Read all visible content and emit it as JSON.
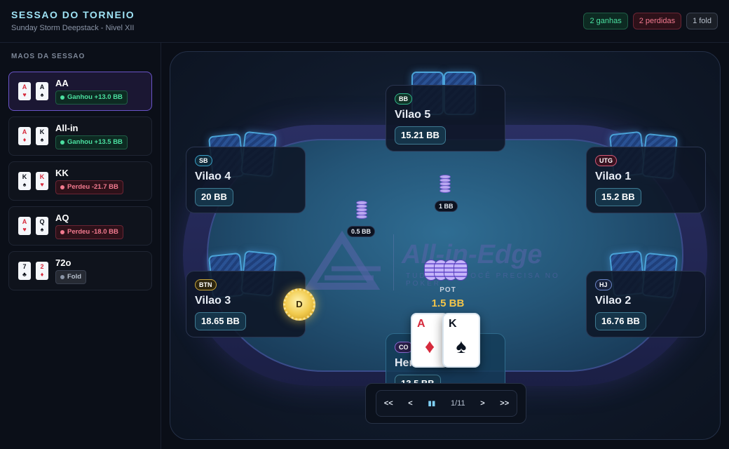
{
  "header": {
    "title": "SESSAO DO TORNEIO",
    "subtitle": "Sunday Storm Deepstack - Nivel XII",
    "badges": {
      "wins": "2 ganhas",
      "losses": "2 perdidas",
      "folds": "1 fold"
    }
  },
  "sidebar": {
    "title": "MAOS DA SESSAO",
    "hands": [
      {
        "name": "AA",
        "cards": [
          {
            "rank": "A",
            "suit": "♥"
          },
          {
            "rank": "A",
            "suit": "♠"
          }
        ],
        "result": "Ganhou +13.0 BB"
      },
      {
        "name": "All-in",
        "cards": [
          {
            "rank": "A",
            "suit": "♦"
          },
          {
            "rank": "K",
            "suit": "♠"
          }
        ],
        "result": "Ganhou +13.5 BB"
      },
      {
        "name": "KK",
        "cards": [
          {
            "rank": "K",
            "suit": "♠"
          },
          {
            "rank": "K",
            "suit": "♥"
          }
        ],
        "result": "Perdeu -21.7 BB"
      },
      {
        "name": "AQ",
        "cards": [
          {
            "rank": "A",
            "suit": "♥"
          },
          {
            "rank": "Q",
            "suit": "♠"
          }
        ],
        "result": "Perdeu -18.0 BB"
      },
      {
        "name": "72o",
        "cards": [
          {
            "rank": "7",
            "suit": "♣"
          },
          {
            "rank": "2",
            "suit": "♦"
          }
        ],
        "result": "Fold"
      }
    ]
  },
  "table": {
    "logo": {
      "name": "All-in-Edge",
      "tagline": "TUDO QUE VOCÊ PRECISA NO POKER"
    },
    "seats": {
      "bb": {
        "position": "BB",
        "name": "Vilao 5",
        "stack": "15.21 BB"
      },
      "sb": {
        "position": "SB",
        "name": "Vilao 4",
        "stack": "20 BB"
      },
      "utg": {
        "position": "UTG",
        "name": "Vilao 1",
        "stack": "15.2 BB"
      },
      "btn": {
        "position": "BTN",
        "name": "Vilao 3",
        "stack": "18.65 BB"
      },
      "hj": {
        "position": "HJ",
        "name": "Vilao 2",
        "stack": "16.76 BB"
      },
      "co": {
        "position": "CO",
        "name": "Hero",
        "stack": "13.5 BB"
      }
    },
    "bets": {
      "sb": "0.5 BB",
      "bb": "1 BB"
    },
    "pot": {
      "label": "POT",
      "value": "1.5 BB"
    },
    "dealer": "D",
    "hero_cards": [
      {
        "rank": "A",
        "suit": "♦"
      },
      {
        "rank": "K",
        "suit": "♠"
      }
    ]
  },
  "controls": {
    "first": "<<",
    "prev": "<",
    "pause": "▮▮",
    "counter": "1/11",
    "next": ">",
    "last": ">>"
  },
  "colors": {
    "accent": "#6a55c8",
    "win": "#4be0a0",
    "loss": "#f27a8f",
    "pot": "#f3c54a",
    "title": "#9fe3f5"
  }
}
